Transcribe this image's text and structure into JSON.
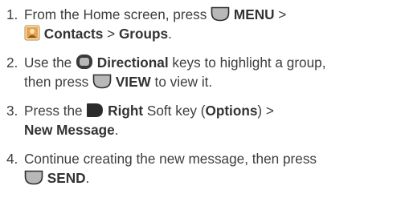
{
  "steps": [
    {
      "number": "1.",
      "line1_text1": "From the Home screen, press",
      "line1_key": "MENU",
      "line1_text2": ">",
      "line2_key1": "Contacts",
      "line2_text": ">",
      "line2_key2": "Groups",
      "line2_end": ".",
      "icons": [
        "soft-key-icon",
        "contacts-app-icon"
      ]
    },
    {
      "number": "2.",
      "line1_text1": "Use the",
      "line1_key": "Directional",
      "line1_text2": "keys to highlight a group,",
      "line2_text1": "then press",
      "line2_key": "VIEW",
      "line2_text2": "to view it.",
      "icons": [
        "directional-key-icon",
        "soft-key-icon"
      ]
    },
    {
      "number": "3.",
      "line1_text1": "Press the",
      "line1_key1": "Right",
      "line1_text2": "Soft key (",
      "line1_key2": "Options",
      "line1_text3": ") >",
      "line2_key": "New Message",
      "line2_end": ".",
      "icons": [
        "right-soft-key-icon"
      ]
    },
    {
      "number": "4.",
      "line1_text": "Continue creating the new message, then press",
      "line2_key": "SEND",
      "line2_end": ".",
      "icons": [
        "soft-key-icon"
      ]
    }
  ],
  "colors": {
    "text": "#3d3d3d",
    "key_fill": "#b8b8b8",
    "key_stroke": "#2e2e2e",
    "icon_orange": "#e8a24a"
  }
}
